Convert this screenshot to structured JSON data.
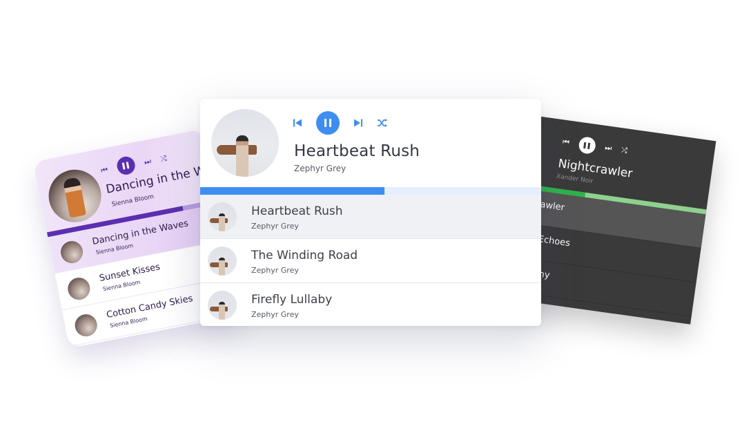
{
  "left_player": {
    "now_playing": {
      "title": "Dancing in the Waves",
      "artist": "Sienna Bloom"
    },
    "controls": {
      "prev_icon": "skip-previous-icon",
      "play_state_icon": "pause-icon",
      "next_icon": "skip-next-icon",
      "shuffle_icon": "shuffle-icon"
    },
    "progress": 0.8,
    "accent_color": "#5b2fb0",
    "tracks": [
      {
        "title": "Dancing in the Waves",
        "artist": "Sienna Bloom",
        "active": true
      },
      {
        "title": "Sunset Kisses",
        "artist": "Sienna Bloom",
        "active": false
      },
      {
        "title": "Cotton Candy Skies",
        "artist": "Sienna Bloom",
        "active": false
      }
    ]
  },
  "main_player": {
    "now_playing": {
      "title": "Heartbeat Rush",
      "artist": "Zephyr Grey"
    },
    "controls": {
      "prev_icon": "skip-previous-icon",
      "play_state_icon": "pause-icon",
      "next_icon": "skip-next-icon",
      "shuffle_icon": "shuffle-icon"
    },
    "progress": 0.54,
    "accent_color": "#3d8ef0",
    "tracks": [
      {
        "title": "Heartbeat Rush",
        "artist": "Zephyr Grey",
        "active": true
      },
      {
        "title": "The Winding Road",
        "artist": "Zephyr Grey",
        "active": false
      },
      {
        "title": "Firefly Lullaby",
        "artist": "Zephyr Grey",
        "active": false
      }
    ]
  },
  "right_player": {
    "now_playing": {
      "title": "Nightcrawler",
      "artist": "Xander Noir"
    },
    "controls": {
      "prev_icon": "skip-previous-icon",
      "play_state_icon": "pause-icon",
      "next_icon": "skip-next-icon",
      "shuffle_icon": "shuffle-icon"
    },
    "progress": 0.32,
    "accent_color": "#2fb34a",
    "tracks": [
      {
        "title": "crawler",
        "artist": "oir",
        "active": true
      },
      {
        "title": "m Echoes",
        "artist": "",
        "active": false
      },
      {
        "title": "phony",
        "artist": "",
        "active": false
      }
    ]
  }
}
